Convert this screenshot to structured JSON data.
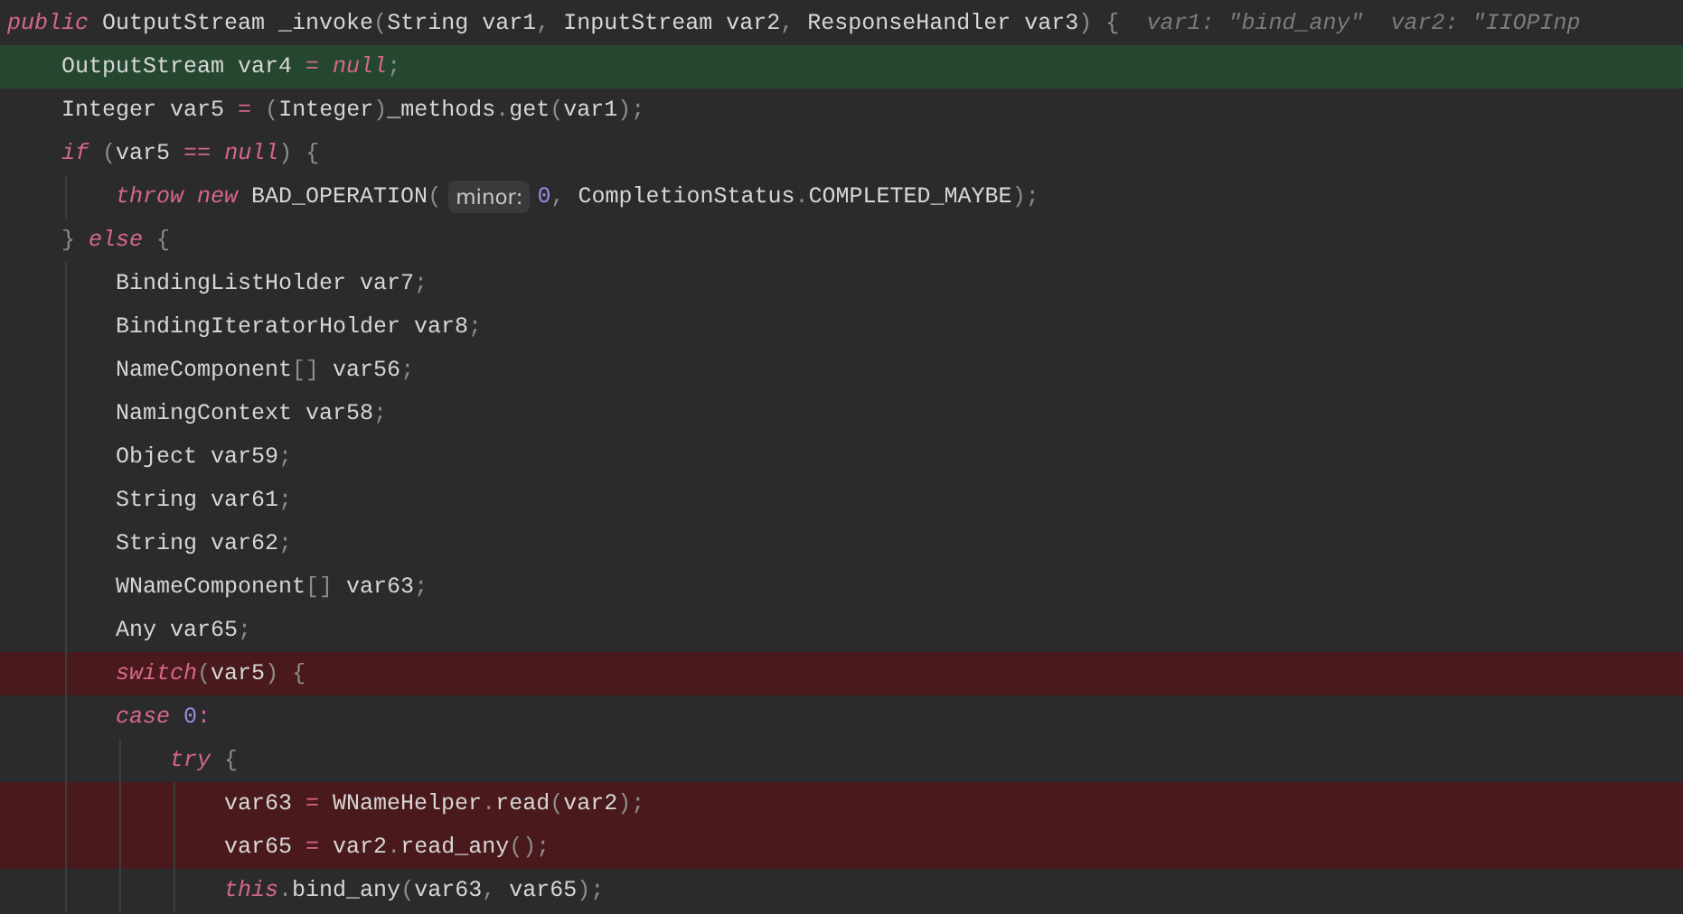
{
  "editor": {
    "lines": [
      {
        "execution_point": false,
        "breakpoint": false,
        "tokens": [
          {
            "kind": "keyword",
            "text": "public"
          },
          {
            "kind": "plain",
            "text": " OutputStream _invoke"
          },
          {
            "kind": "punct",
            "text": "("
          },
          {
            "kind": "plain",
            "text": "String var1"
          },
          {
            "kind": "punct",
            "text": ", "
          },
          {
            "kind": "plain",
            "text": "InputStream var2"
          },
          {
            "kind": "punct",
            "text": ", "
          },
          {
            "kind": "plain",
            "text": "ResponseHandler var3"
          },
          {
            "kind": "punct",
            "text": ") {"
          }
        ],
        "inline_values": "var1: \"bind_any\"  var2: \"IIOPInp"
      },
      {
        "execution_point": true,
        "breakpoint": false,
        "tokens": [
          {
            "kind": "plain",
            "text": "    OutputStream var4 "
          },
          {
            "kind": "operator",
            "text": "="
          },
          {
            "kind": "keyword",
            "text": " null"
          },
          {
            "kind": "punct",
            "text": ";"
          }
        ]
      },
      {
        "execution_point": false,
        "breakpoint": false,
        "tokens": [
          {
            "kind": "plain",
            "text": "    Integer var5 "
          },
          {
            "kind": "operator",
            "text": "="
          },
          {
            "kind": "punct",
            "text": " ("
          },
          {
            "kind": "plain",
            "text": "Integer"
          },
          {
            "kind": "punct",
            "text": ")"
          },
          {
            "kind": "plain",
            "text": "_methods"
          },
          {
            "kind": "punct",
            "text": "."
          },
          {
            "kind": "plain",
            "text": "get"
          },
          {
            "kind": "punct",
            "text": "("
          },
          {
            "kind": "plain",
            "text": "var1"
          },
          {
            "kind": "punct",
            "text": ");"
          }
        ]
      },
      {
        "execution_point": false,
        "breakpoint": false,
        "tokens": [
          {
            "kind": "keyword",
            "text": "    if"
          },
          {
            "kind": "punct",
            "text": " ("
          },
          {
            "kind": "plain",
            "text": "var5 "
          },
          {
            "kind": "operator",
            "text": "=="
          },
          {
            "kind": "keyword",
            "text": " null"
          },
          {
            "kind": "punct",
            "text": ") {"
          }
        ]
      },
      {
        "execution_point": false,
        "breakpoint": false,
        "tokens": [
          {
            "kind": "keyword",
            "text": "        throw new"
          },
          {
            "kind": "plain",
            "text": " BAD_OPERATION"
          },
          {
            "kind": "punct",
            "text": "("
          }
        ],
        "parameter_hint": "minor:",
        "rest": [
          {
            "kind": "number",
            "text": "0"
          },
          {
            "kind": "punct",
            "text": ", "
          },
          {
            "kind": "plain",
            "text": "CompletionStatus"
          },
          {
            "kind": "punct",
            "text": "."
          },
          {
            "kind": "plain",
            "text": "COMPLETED_MAYBE"
          },
          {
            "kind": "punct",
            "text": ");"
          }
        ]
      },
      {
        "execution_point": false,
        "breakpoint": false,
        "tokens": [
          {
            "kind": "punct",
            "text": "    } "
          },
          {
            "kind": "keyword",
            "text": "else"
          },
          {
            "kind": "punct",
            "text": " {"
          }
        ]
      },
      {
        "execution_point": false,
        "breakpoint": false,
        "tokens": [
          {
            "kind": "plain",
            "text": "        BindingListHolder var7"
          },
          {
            "kind": "punct",
            "text": ";"
          }
        ]
      },
      {
        "execution_point": false,
        "breakpoint": false,
        "tokens": [
          {
            "kind": "plain",
            "text": "        BindingIteratorHolder var8"
          },
          {
            "kind": "punct",
            "text": ";"
          }
        ]
      },
      {
        "execution_point": false,
        "breakpoint": false,
        "tokens": [
          {
            "kind": "plain",
            "text": "        NameComponent"
          },
          {
            "kind": "punct",
            "text": "[] "
          },
          {
            "kind": "plain",
            "text": "var56"
          },
          {
            "kind": "punct",
            "text": ";"
          }
        ]
      },
      {
        "execution_point": false,
        "breakpoint": false,
        "tokens": [
          {
            "kind": "plain",
            "text": "        NamingContext var58"
          },
          {
            "kind": "punct",
            "text": ";"
          }
        ]
      },
      {
        "execution_point": false,
        "breakpoint": false,
        "tokens": [
          {
            "kind": "plain",
            "text": "        Object var59"
          },
          {
            "kind": "punct",
            "text": ";"
          }
        ]
      },
      {
        "execution_point": false,
        "breakpoint": false,
        "tokens": [
          {
            "kind": "plain",
            "text": "        String var61"
          },
          {
            "kind": "punct",
            "text": ";"
          }
        ]
      },
      {
        "execution_point": false,
        "breakpoint": false,
        "tokens": [
          {
            "kind": "plain",
            "text": "        String var62"
          },
          {
            "kind": "punct",
            "text": ";"
          }
        ]
      },
      {
        "execution_point": false,
        "breakpoint": false,
        "tokens": [
          {
            "kind": "plain",
            "text": "        WNameComponent"
          },
          {
            "kind": "punct",
            "text": "[] "
          },
          {
            "kind": "plain",
            "text": "var63"
          },
          {
            "kind": "punct",
            "text": ";"
          }
        ]
      },
      {
        "execution_point": false,
        "breakpoint": false,
        "tokens": [
          {
            "kind": "plain",
            "text": "        Any var65"
          },
          {
            "kind": "punct",
            "text": ";"
          }
        ]
      },
      {
        "execution_point": false,
        "breakpoint": true,
        "tokens": [
          {
            "kind": "keyword",
            "text": "        switch"
          },
          {
            "kind": "punct",
            "text": "("
          },
          {
            "kind": "plain",
            "text": "var5"
          },
          {
            "kind": "punct",
            "text": ") {"
          }
        ]
      },
      {
        "execution_point": false,
        "breakpoint": false,
        "tokens": [
          {
            "kind": "keyword",
            "text": "        case"
          },
          {
            "kind": "number",
            "text": " 0"
          },
          {
            "kind": "operator",
            "text": ":"
          }
        ]
      },
      {
        "execution_point": false,
        "breakpoint": false,
        "tokens": [
          {
            "kind": "keyword",
            "text": "            try"
          },
          {
            "kind": "punct",
            "text": " {"
          }
        ]
      },
      {
        "execution_point": false,
        "breakpoint": true,
        "tokens": [
          {
            "kind": "plain",
            "text": "                var63 "
          },
          {
            "kind": "operator",
            "text": "="
          },
          {
            "kind": "plain",
            "text": " WNameHelper"
          },
          {
            "kind": "punct",
            "text": "."
          },
          {
            "kind": "plain",
            "text": "read"
          },
          {
            "kind": "punct",
            "text": "("
          },
          {
            "kind": "plain",
            "text": "var2"
          },
          {
            "kind": "punct",
            "text": ");"
          }
        ]
      },
      {
        "execution_point": false,
        "breakpoint": true,
        "tokens": [
          {
            "kind": "plain",
            "text": "                var65 "
          },
          {
            "kind": "operator",
            "text": "="
          },
          {
            "kind": "plain",
            "text": " var2"
          },
          {
            "kind": "punct",
            "text": "."
          },
          {
            "kind": "plain",
            "text": "read_any"
          },
          {
            "kind": "punct",
            "text": "();"
          }
        ]
      },
      {
        "execution_point": false,
        "breakpoint": false,
        "tokens": [
          {
            "kind": "keyword",
            "text": "                this"
          },
          {
            "kind": "punct",
            "text": "."
          },
          {
            "kind": "plain",
            "text": "bind_any"
          },
          {
            "kind": "punct",
            "text": "("
          },
          {
            "kind": "plain",
            "text": "var63"
          },
          {
            "kind": "punct",
            "text": ", "
          },
          {
            "kind": "plain",
            "text": "var65"
          },
          {
            "kind": "punct",
            "text": ");"
          }
        ]
      }
    ]
  }
}
